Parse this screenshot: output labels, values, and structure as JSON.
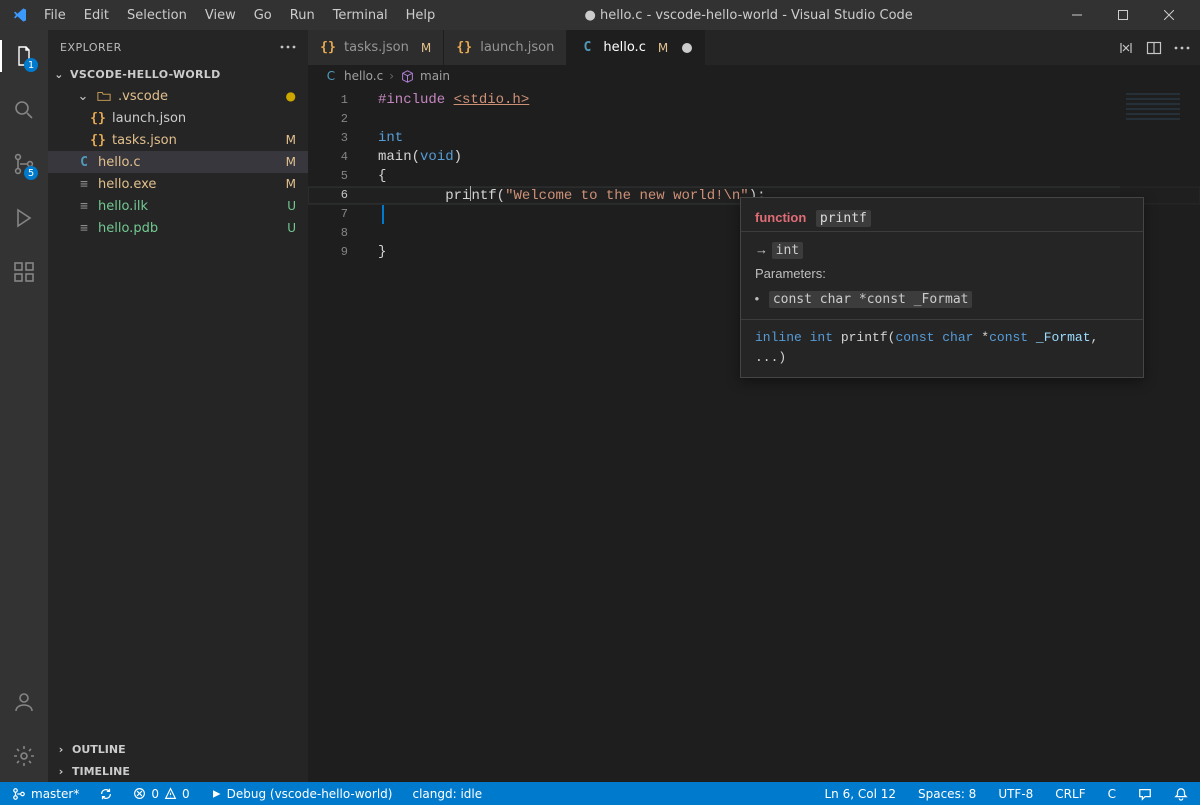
{
  "window": {
    "title_dirty_dot": "●",
    "title": "hello.c - vscode-hello-world - Visual Studio Code"
  },
  "menubar": [
    "File",
    "Edit",
    "Selection",
    "View",
    "Go",
    "Run",
    "Terminal",
    "Help"
  ],
  "activity": {
    "explorer_badge": "1",
    "scm_badge": "5"
  },
  "sidebar": {
    "title": "EXPLORER",
    "folder": "VSCODE-HELLO-WORLD",
    "tree": [
      {
        "indent": 1,
        "kind": "folder-open",
        "label": ".vscode",
        "status": "dot",
        "statusColor": "folder-dot",
        "textColor": "yellow"
      },
      {
        "indent": 2,
        "kind": "json",
        "label": "launch.json",
        "status": "",
        "textColor": ""
      },
      {
        "indent": 2,
        "kind": "json",
        "label": "tasks.json",
        "status": "M",
        "statusColor": "yellow",
        "textColor": "yellow"
      },
      {
        "indent": 1,
        "kind": "c",
        "label": "hello.c",
        "status": "M",
        "statusColor": "yellow",
        "selected": true,
        "textColor": "yellow"
      },
      {
        "indent": 1,
        "kind": "bin",
        "label": "hello.exe",
        "status": "M",
        "statusColor": "yellow",
        "textColor": "yellow"
      },
      {
        "indent": 1,
        "kind": "bin",
        "label": "hello.ilk",
        "status": "U",
        "statusColor": "green",
        "textColor": "green"
      },
      {
        "indent": 1,
        "kind": "bin",
        "label": "hello.pdb",
        "status": "U",
        "statusColor": "green",
        "textColor": "green"
      }
    ],
    "outline": "OUTLINE",
    "timeline": "TIMELINE"
  },
  "tabs": [
    {
      "icon": "json",
      "label": "tasks.json",
      "badge": "M",
      "badgeColor": "yellow",
      "active": false
    },
    {
      "icon": "json",
      "label": "launch.json",
      "badge": "",
      "active": false
    },
    {
      "icon": "c",
      "label": "hello.c",
      "badge": "M",
      "badgeColor": "yellow",
      "active": true,
      "dirty": true
    }
  ],
  "breadcrumb": {
    "file_icon": "c",
    "file": "hello.c",
    "symbol_icon": "symbol-function",
    "symbol": "main"
  },
  "code": {
    "lines": [
      [
        {
          "t": "#include ",
          "c": "include"
        },
        {
          "t": "<stdio.h>",
          "c": "str",
          "u": true
        }
      ],
      [],
      [
        {
          "t": "int",
          "c": "kw"
        }
      ],
      [
        {
          "t": "main",
          "c": "lt"
        },
        {
          "t": "(",
          "c": "lt"
        },
        {
          "t": "void",
          "c": "kw"
        },
        {
          "t": ")",
          "c": "lt"
        }
      ],
      [
        {
          "t": "{",
          "c": "lt"
        }
      ],
      [
        {
          "t": "        ",
          "c": "lt"
        },
        {
          "t": "pri",
          "c": "lt"
        },
        {
          "cursor": true
        },
        {
          "t": "ntf",
          "c": "lt"
        },
        {
          "t": "(",
          "c": "lt"
        },
        {
          "t": "\"Welcome to the new world!\\n\"",
          "c": "str"
        },
        {
          "t": ");",
          "c": "lt"
        }
      ],
      [
        {
          "t": "",
          "c": "lt"
        }
      ],
      [],
      [
        {
          "t": "}",
          "c": "lt"
        }
      ]
    ],
    "current_line": 6
  },
  "hover": {
    "keyword": "function",
    "name": "printf",
    "return_arrow": "→",
    "return_type": "int",
    "params_label": "Parameters:",
    "param": "const char *const _Format",
    "signature_tokens": [
      {
        "t": "inline ",
        "c": "kw"
      },
      {
        "t": "int ",
        "c": "kw"
      },
      {
        "t": "printf",
        "c": "lt"
      },
      {
        "t": "(",
        "c": "lt"
      },
      {
        "t": "const char ",
        "c": "kw"
      },
      {
        "t": "*",
        "c": "lt"
      },
      {
        "t": "const ",
        "c": "kw"
      },
      {
        "t": "_Format",
        "c": "param"
      },
      {
        "t": ", ...)",
        "c": "lt"
      }
    ]
  },
  "status": {
    "branch": "master*",
    "errors": "0",
    "warnings": "0",
    "debug_label": "Debug (vscode-hello-world)",
    "lsp": "clangd: idle",
    "pos": "Ln 6, Col 12",
    "spaces": "Spaces: 8",
    "encoding": "UTF-8",
    "eol": "CRLF",
    "lang": "C"
  }
}
